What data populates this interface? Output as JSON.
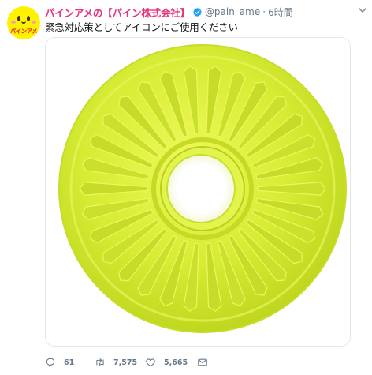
{
  "tweet": {
    "avatar_text": "パインアメ",
    "display_name": "パインアメの【パイン株式会社】",
    "handle": "@pain_ame",
    "separator": "·",
    "time": "6時間",
    "text": "緊急対応策としてアイコンにご使用ください",
    "media_icon": "pineapple-candy-photo",
    "verified_icon": "verified-badge-icon",
    "colors": {
      "display_name": "#e8327a",
      "verified": "#1da1f2",
      "meta": "#657786",
      "candy": "#d9ee38"
    }
  },
  "actions": {
    "reply": {
      "icon": "reply-icon",
      "count": "61"
    },
    "retweet": {
      "icon": "retweet-icon",
      "count": "7,575"
    },
    "like": {
      "icon": "heart-icon",
      "count": "5,665"
    },
    "dm": {
      "icon": "envelope-icon"
    }
  }
}
